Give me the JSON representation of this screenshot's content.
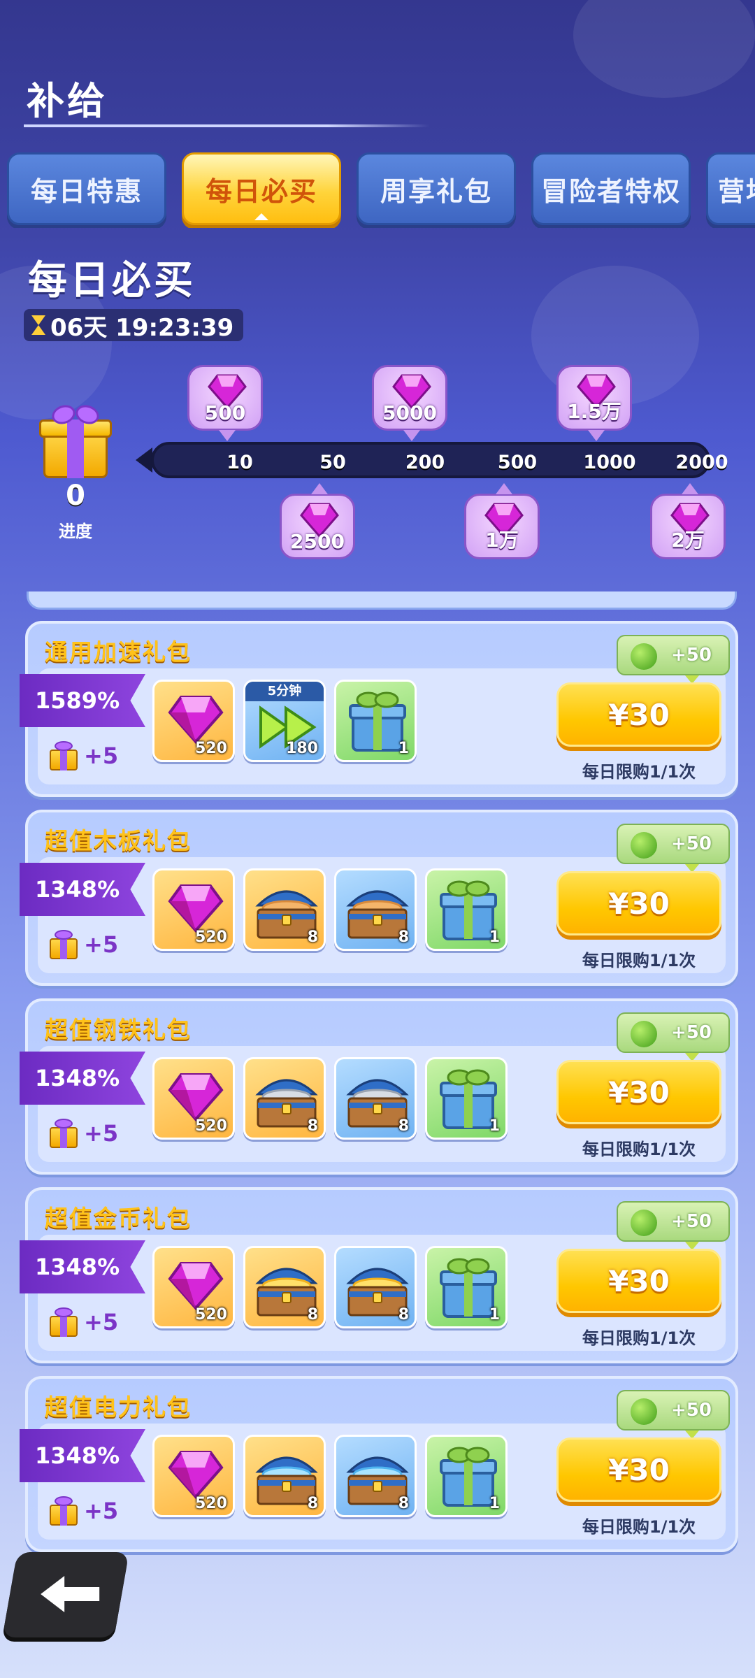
{
  "header": {
    "title": "补给"
  },
  "tabs": [
    {
      "label": "每日特惠",
      "active": false
    },
    {
      "label": "每日必买",
      "active": true
    },
    {
      "label": "周享礼包",
      "active": false
    },
    {
      "label": "冒险者特权",
      "active": false
    },
    {
      "label": "营地",
      "active": false
    }
  ],
  "section": {
    "title": "每日必买",
    "timer": "06天 19:23:39"
  },
  "progress": {
    "value": "0",
    "label": "进度",
    "ticks": [
      "10",
      "50",
      "200",
      "500",
      "1000",
      "2000"
    ],
    "rewards": [
      {
        "amount": "500",
        "tier": "10"
      },
      {
        "amount": "2500",
        "tier": "50"
      },
      {
        "amount": "5000",
        "tier": "200"
      },
      {
        "amount": "1万",
        "tier": "500"
      },
      {
        "amount": "1.5万",
        "tier": "1000"
      },
      {
        "amount": "2万",
        "tier": "2000"
      }
    ]
  },
  "packs": [
    {
      "name": "通用加速礼包",
      "ratio": "1589%",
      "gift_bonus": "+5",
      "apple_bonus": "+50",
      "price": "¥30",
      "limit": "每日限购1/1次",
      "items": [
        {
          "type": "gem",
          "bg": "gold",
          "qty": "520"
        },
        {
          "type": "speed",
          "bg": "blue",
          "qty": "180",
          "tag": "5分钟"
        },
        {
          "type": "giftbox",
          "bg": "green",
          "qty": "1"
        }
      ]
    },
    {
      "name": "超值木板礼包",
      "ratio": "1348%",
      "gift_bonus": "+5",
      "apple_bonus": "+50",
      "price": "¥30",
      "limit": "每日限购1/1次",
      "items": [
        {
          "type": "gem",
          "bg": "gold",
          "qty": "520"
        },
        {
          "type": "chest-wood",
          "bg": "gold",
          "qty": "8"
        },
        {
          "type": "chest-wood",
          "bg": "blue",
          "qty": "8"
        },
        {
          "type": "giftbox",
          "bg": "green",
          "qty": "1"
        }
      ]
    },
    {
      "name": "超值钢铁礼包",
      "ratio": "1348%",
      "gift_bonus": "+5",
      "apple_bonus": "+50",
      "price": "¥30",
      "limit": "每日限购1/1次",
      "items": [
        {
          "type": "gem",
          "bg": "gold",
          "qty": "520"
        },
        {
          "type": "chest-steel",
          "bg": "gold",
          "qty": "8"
        },
        {
          "type": "chest-steel",
          "bg": "blue",
          "qty": "8"
        },
        {
          "type": "giftbox",
          "bg": "green",
          "qty": "1"
        }
      ]
    },
    {
      "name": "超值金币礼包",
      "ratio": "1348%",
      "gift_bonus": "+5",
      "apple_bonus": "+50",
      "price": "¥30",
      "limit": "每日限购1/1次",
      "items": [
        {
          "type": "gem",
          "bg": "gold",
          "qty": "520"
        },
        {
          "type": "chest-coin",
          "bg": "gold",
          "qty": "8"
        },
        {
          "type": "chest-coin",
          "bg": "blue",
          "qty": "8"
        },
        {
          "type": "giftbox",
          "bg": "green",
          "qty": "1"
        }
      ]
    },
    {
      "name": "超值电力礼包",
      "ratio": "1348%",
      "gift_bonus": "+5",
      "apple_bonus": "+50",
      "price": "¥30",
      "limit": "每日限购1/1次",
      "items": [
        {
          "type": "gem",
          "bg": "gold",
          "qty": "520"
        },
        {
          "type": "chest-power",
          "bg": "gold",
          "qty": "8"
        },
        {
          "type": "chest-power",
          "bg": "blue",
          "qty": "8"
        },
        {
          "type": "giftbox",
          "bg": "green",
          "qty": "1"
        }
      ]
    }
  ],
  "colors": {
    "active_tab": "#ffd43b",
    "tab": "#4a73cc",
    "price_button": "#ffc700",
    "ribbon": "#7b34c6",
    "pack_name": "#ffc21a"
  },
  "icons": {
    "back": "back-arrow-icon",
    "timer": "hourglass-icon",
    "gem": "purple-gem-icon",
    "gift": "gift-icon",
    "apple": "green-apple-icon"
  }
}
